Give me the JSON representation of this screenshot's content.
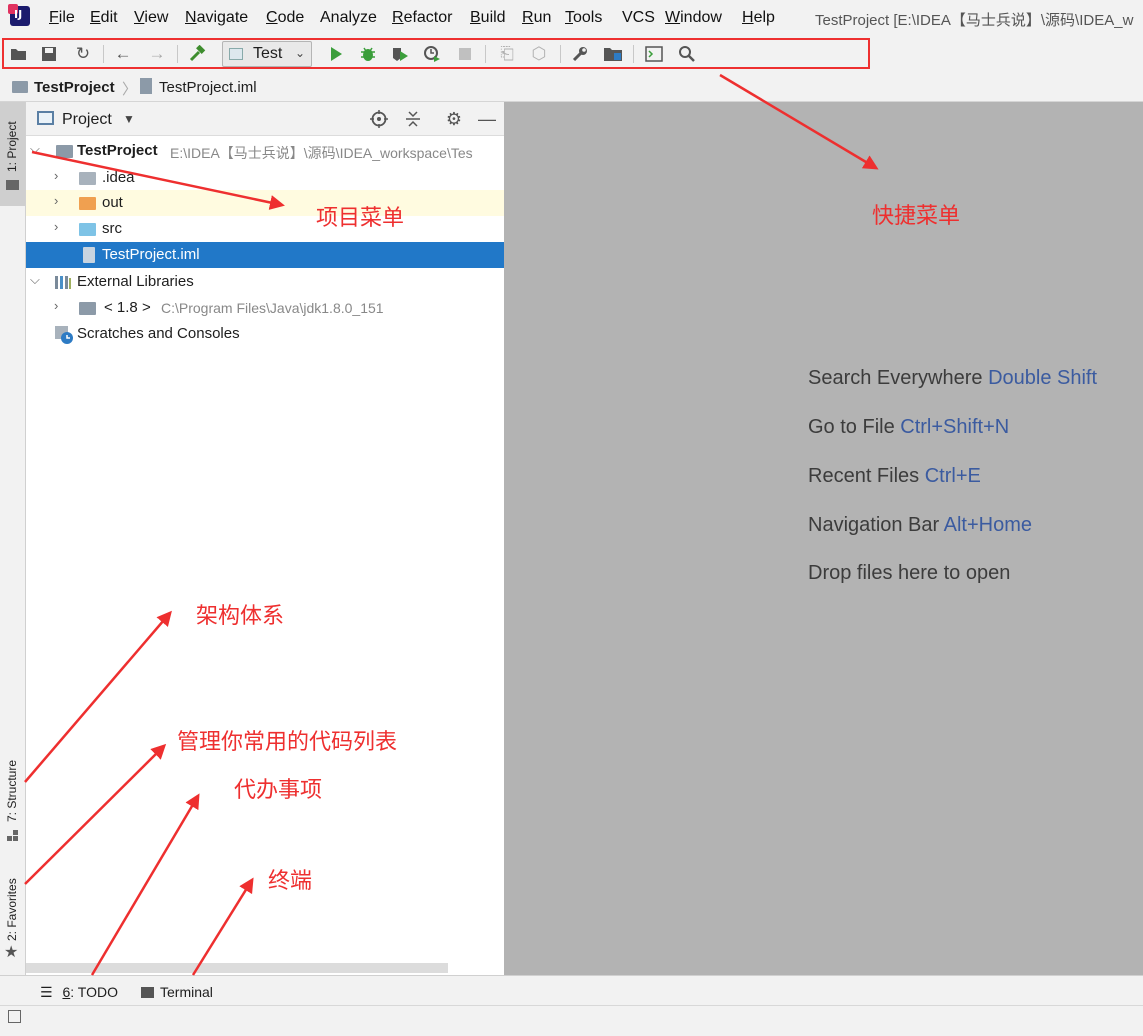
{
  "menu": {
    "items": [
      {
        "label": "File",
        "mnemonic": "F",
        "rest": "ile"
      },
      {
        "label": "Edit",
        "mnemonic": "E",
        "rest": "dit"
      },
      {
        "label": "View",
        "mnemonic": "V",
        "rest": "iew"
      },
      {
        "label": "Navigate",
        "mnemonic": "N",
        "rest": "avigate"
      },
      {
        "label": "Code",
        "mnemonic": "C",
        "rest": "ode"
      },
      {
        "label": "Analyze",
        "mnemonic": "",
        "rest": "Analyze"
      },
      {
        "label": "Refactor",
        "mnemonic": "R",
        "rest": "efactor"
      },
      {
        "label": "Build",
        "mnemonic": "B",
        "rest": "uild"
      },
      {
        "label": "Run",
        "mnemonic": "R",
        "rest": "un"
      },
      {
        "label": "Tools",
        "mnemonic": "T",
        "rest": "ools"
      },
      {
        "label": "VCS",
        "mnemonic": "",
        "rest": "VCS"
      },
      {
        "label": "Window",
        "mnemonic": "W",
        "rest": "indow"
      },
      {
        "label": "Help",
        "mnemonic": "H",
        "rest": "elp"
      }
    ]
  },
  "window_title": "TestProject [E:\\IDEA【马士兵说】\\源码\\IDEA_w",
  "toolbar": {
    "run_config": "Test",
    "icons": [
      "open-icon",
      "save-icon",
      "sync-icon",
      "back-icon",
      "forward-icon",
      "build-icon",
      "run-icon",
      "debug-icon",
      "coverage-icon",
      "profile-icon",
      "stop-icon",
      "attach-icon",
      "deploy-icon",
      "settings-wrench-icon",
      "project-structure-icon",
      "terminal-icon",
      "search-icon"
    ]
  },
  "navbar": {
    "project": "TestProject",
    "file": "TestProject.iml"
  },
  "left_strip": {
    "project_tab": "1: Project",
    "structure_tab": "7: Structure",
    "favorites_tab": "2: Favorites"
  },
  "project_panel": {
    "title": "Project",
    "tree": {
      "root_label": "TestProject",
      "root_path": "E:\\IDEA【马士兵说】\\源码\\IDEA_workspace\\Tes",
      "idea": ".idea",
      "out": "out",
      "src": "src",
      "iml": "TestProject.iml",
      "external_libraries": "External Libraries",
      "jdk_label": "< 1.8 >",
      "jdk_path": "C:\\Program Files\\Java\\jdk1.8.0_151",
      "scratches": "Scratches and Consoles"
    }
  },
  "editor": {
    "hints": [
      {
        "text": "Search Everywhere",
        "shortcut": "Double Shift"
      },
      {
        "text": "Go to File",
        "shortcut": "Ctrl+Shift+N"
      },
      {
        "text": "Recent Files",
        "shortcut": "Ctrl+E"
      },
      {
        "text": "Navigation Bar",
        "shortcut": "Alt+Home"
      },
      {
        "text": "Drop files here to open",
        "shortcut": ""
      }
    ]
  },
  "bottom_bar": {
    "todo": "TODO",
    "todo_num": "6",
    "terminal": "Terminal"
  },
  "annotations": {
    "project_menu": "项目菜单",
    "shortcut_menu": "快捷菜单",
    "structure": "架构体系",
    "favorites": "管理你常用的代码列表",
    "todo": "代办事项",
    "terminal": "终端"
  },
  "colors": {
    "annotation": "#ee2f2f",
    "selection": "#2178c8",
    "editor_bg": "#b3b3b3",
    "shortcut": "#3b5ba0"
  }
}
